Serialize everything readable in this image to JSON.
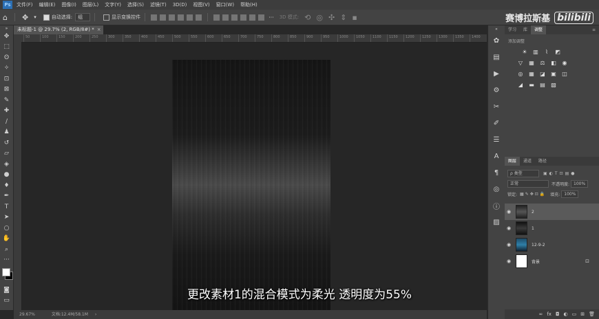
{
  "menu": [
    "文件(F)",
    "编辑(E)",
    "图像(I)",
    "图层(L)",
    "文字(Y)",
    "选择(S)",
    "滤镜(T)",
    "3D(D)",
    "视图(V)",
    "窗口(W)",
    "帮助(H)"
  ],
  "options": {
    "auto_select_label": "自动选择:",
    "auto_select_value": "组",
    "show_transform_label": "显示变换控件",
    "mode_3d_label": "3D 模式:"
  },
  "watermark": {
    "text": "赛博拉斯基",
    "brand": "bilibili"
  },
  "document": {
    "tab_title": "未标题-1 @ 29.7% (2, RGB/8#) *",
    "close": "×"
  },
  "ruler_top": [
    "50",
    "100",
    "150",
    "200",
    "250",
    "300",
    "350",
    "400",
    "450",
    "500",
    "550",
    "600",
    "650",
    "700",
    "750",
    "800",
    "850",
    "900",
    "950",
    "1000",
    "1050",
    "1100",
    "1150",
    "1200",
    "1250",
    "1300",
    "1350",
    "1400"
  ],
  "status": {
    "zoom": "29.67%",
    "doc_info": "文档:12.4M/58.1M"
  },
  "subtitle": "更改素材1的混合模式为柔光 透明度为55%",
  "panels": {
    "top_tabs": [
      "学习",
      "库",
      "调整"
    ],
    "active_top_tab": "调整",
    "adjust_label": "添加调整",
    "layer_tabs": [
      "图层",
      "通道",
      "路径"
    ],
    "filter_label": "ρ 类型",
    "blend_mode": "正常",
    "opacity_label": "不透明度:",
    "opacity_value": "100%",
    "lock_label": "锁定:",
    "fill_label": "填充:",
    "fill_value": "100%"
  },
  "layers": [
    {
      "name": "2",
      "selected": true
    },
    {
      "name": "1",
      "selected": false
    },
    {
      "name": "12-9-2",
      "selected": false
    },
    {
      "name": "背景",
      "selected": false,
      "locked": true
    }
  ],
  "colors": {
    "foreground": "#ffffff",
    "background": "#000000",
    "ps_blue": "#2c6fb3"
  }
}
